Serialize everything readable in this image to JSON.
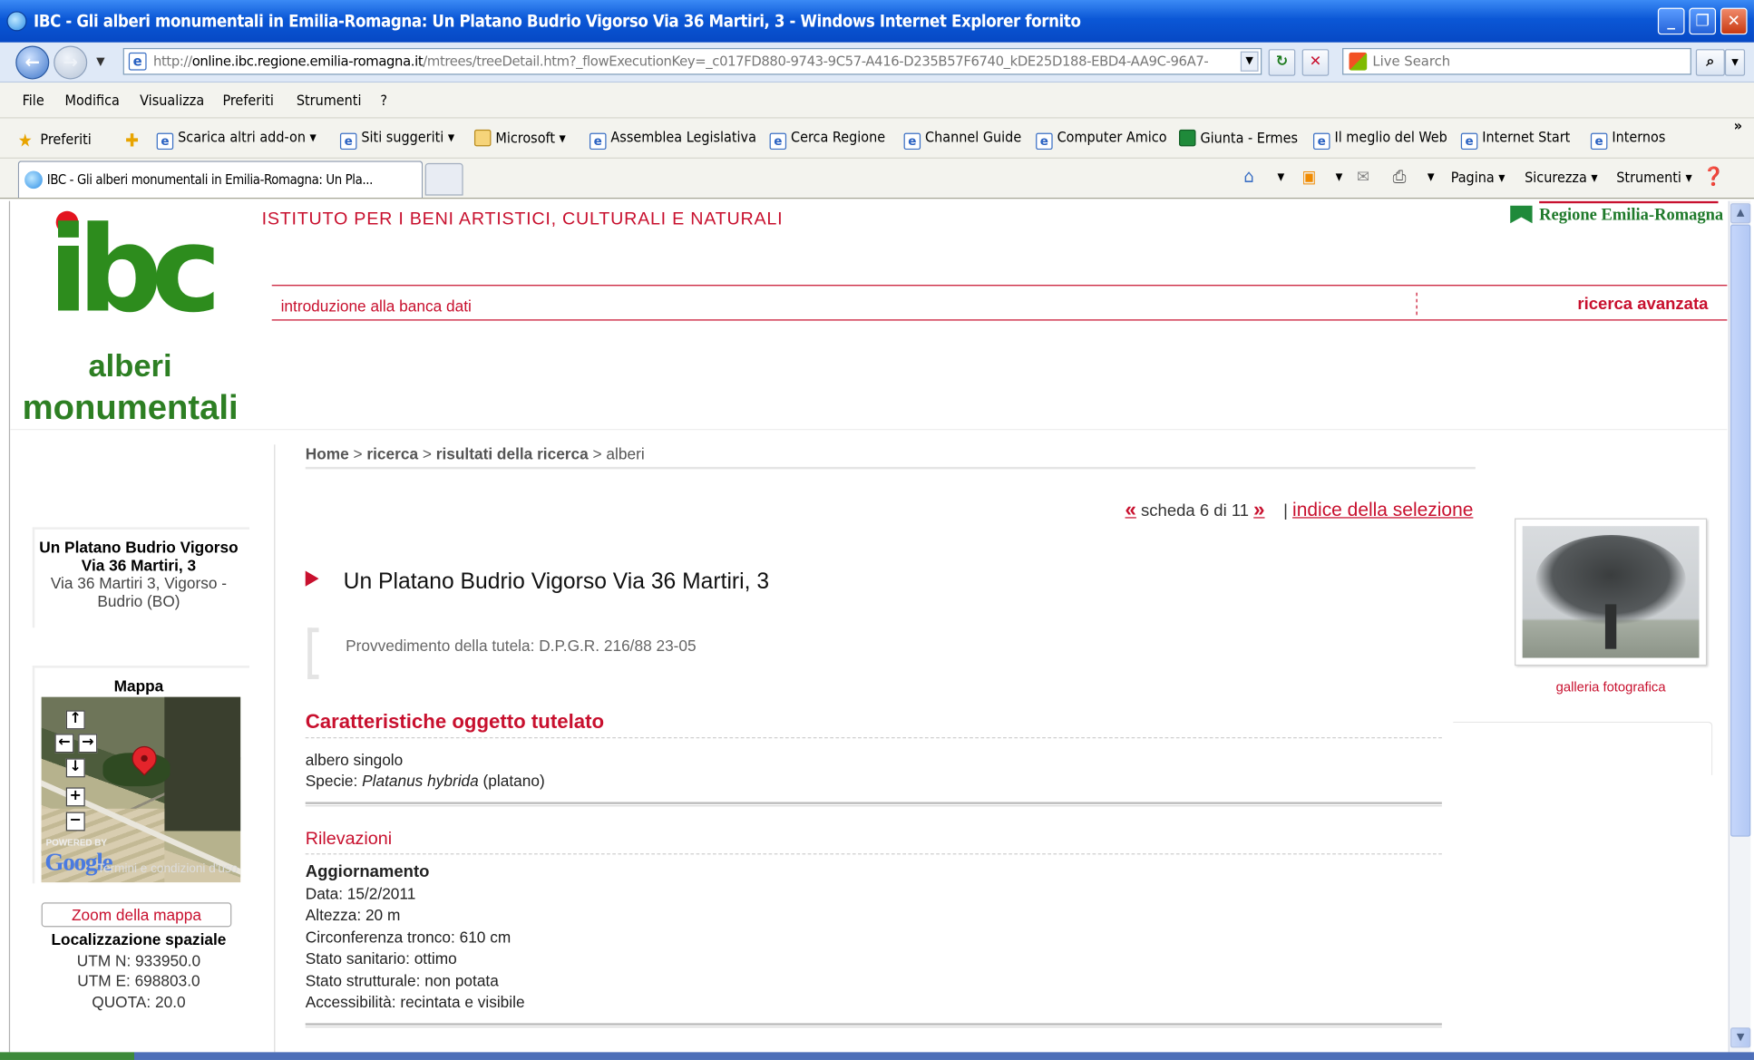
{
  "window": {
    "title": "IBC - Gli alberi monumentali in Emilia-Romagna: Un Platano Budrio Vigorso Via 36 Martiri, 3 - Windows Internet Explorer fornito",
    "minimize": "_",
    "maximize": "❐",
    "close": "✕"
  },
  "address": {
    "url_prefix": "http://",
    "url_host": "online.ibc.regione.emilia-romagna.it",
    "url_path": "/mtrees/treeDetail.htm?_flowExecutionKey=_c017FD880-9743-9C57-A416-D235B57F6740_kDE25D188-EBD4-AA9C-96A7-",
    "search_placeholder": "Live Search"
  },
  "menu": [
    "File",
    "Modifica",
    "Visualizza",
    "Preferiti",
    "Strumenti",
    "?"
  ],
  "favorites": {
    "label": "Preferiti",
    "items": [
      "Scarica altri add-on ▾",
      "Siti suggeriti ▾",
      "Microsoft ▾",
      "Assemblea Legislativa",
      "Cerca Regione",
      "Channel Guide",
      "Computer Amico",
      "Giunta - Ermes",
      "Il meglio del Web",
      "Internet Start",
      "Internos"
    ],
    "more": "»"
  },
  "tab": {
    "label": "IBC - Gli alberi monumentali in Emilia-Romagna: Un Pla..."
  },
  "commands": {
    "pagina": "Pagina ▾",
    "sicurezza": "Sicurezza ▾",
    "strumenti": "Strumenti ▾"
  },
  "site": {
    "logo_text": "ibc",
    "logo_line1": "alberi",
    "logo_line2": "monumentali",
    "institute": "ISTITUTO PER I BENI ARTISTICI, CULTURALI E NATURALI",
    "regione": "Regione Emilia-Romagna",
    "nav_intro": "introduzione alla banca dati",
    "nav_advanced": "ricerca avanzata"
  },
  "sidebar": {
    "tree_name": "Un Platano Budrio Vigorso Via 36 Martiri, 3",
    "tree_address": "Via 36 Martiri 3, Vigorso - Budrio (BO)",
    "map_title": "Mappa",
    "map_powered": "POWERED BY",
    "map_google": "Google",
    "map_terms": "Termini e condizioni d'uso",
    "zoom_label": "Zoom della mappa",
    "loc_title": "Localizzazione spaziale",
    "utm_n": "UTM N: 933950.0",
    "utm_e": "UTM E: 698803.0",
    "quota": "QUOTA: 20.0"
  },
  "breadcrumb": {
    "home": "Home",
    "ricerca": "ricerca",
    "risultati": "risultati della ricerca",
    "current": "alberi",
    "sep": ">"
  },
  "pager": {
    "prev": "«",
    "text": "scheda 6 di 11",
    "next": "»",
    "sep": "|",
    "index": "indice della selezione"
  },
  "detail": {
    "title": "Un Platano Budrio Vigorso Via 36 Martiri, 3",
    "provvedimento": "Provvedimento della tutela: D.P.G.R. 216/88 23-05",
    "sec1_title": "Caratteristiche oggetto tutelato",
    "tipo": "albero singolo",
    "specie_label": "Specie:",
    "specie_latin": "Platanus hybrida",
    "specie_common": "(platano)",
    "sec2_title": "Rilevazioni",
    "agg_title": "Aggiornamento",
    "data": "Data: 15/2/2011",
    "altezza": "Altezza: 20 m",
    "circonferenza": "Circonferenza tronco: 610 cm",
    "sanitario": "Stato sanitario: ottimo",
    "strutturale": "Stato strutturale: non potata",
    "accessibilita": "Accessibilità: recintata e visibile"
  },
  "gallery": {
    "label": "galleria fotografica"
  }
}
